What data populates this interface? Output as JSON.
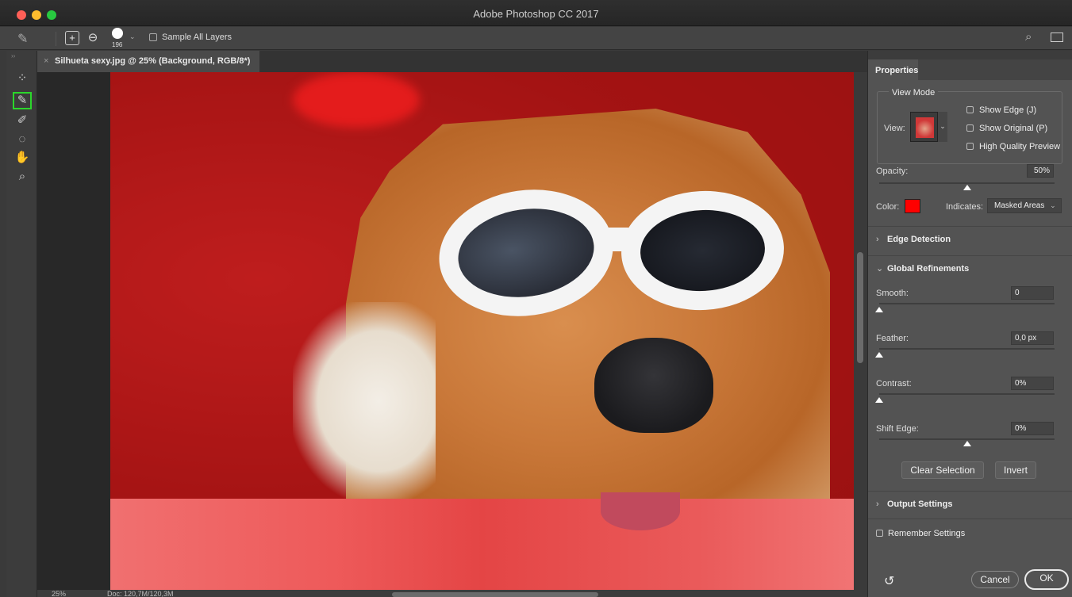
{
  "window": {
    "title": "Adobe Photoshop CC 2017"
  },
  "options_bar": {
    "brush_size": "196",
    "sample_all_layers_label": "Sample All Layers",
    "sample_all_layers_checked": false
  },
  "toolbar": {
    "tools": [
      "quick-selection-tool",
      "refine-edge-brush-tool",
      "brush-tool",
      "lasso-tool",
      "hand-tool",
      "zoom-tool"
    ],
    "active_tool": "refine-edge-brush-tool",
    "highlight_color": "#2bd62b"
  },
  "document": {
    "tab_title": "Silhueta sexy.jpg @ 25% (Background, RGB/8*)",
    "zoom": "25%",
    "doc_info": "Doc: 120,7M/120,3M",
    "overlay_color": "#ff0000"
  },
  "properties": {
    "tab_label": "Properties",
    "view_mode": {
      "title": "View Mode",
      "view_label": "View:",
      "options": [
        {
          "label": "Show Edge (J)",
          "checked": false
        },
        {
          "label": "Show Original (P)",
          "checked": false
        },
        {
          "label": "High Quality Preview",
          "checked": false
        }
      ]
    },
    "opacity": {
      "label": "Opacity:",
      "value": "50%",
      "fraction": 0.5
    },
    "color": {
      "label": "Color:",
      "swatch": "#ff0000"
    },
    "indicates": {
      "label": "Indicates:",
      "value": "Masked Areas"
    },
    "edge_detection": {
      "title": "Edge Detection",
      "expanded": false
    },
    "global_refinements": {
      "title": "Global Refinements",
      "expanded": true,
      "smooth": {
        "label": "Smooth:",
        "value": "0",
        "fraction": 0.0
      },
      "feather": {
        "label": "Feather:",
        "value": "0,0 px",
        "fraction": 0.0
      },
      "contrast": {
        "label": "Contrast:",
        "value": "0%",
        "fraction": 0.0
      },
      "shift_edge": {
        "label": "Shift Edge:",
        "value": "0%",
        "fraction": 0.5
      }
    },
    "buttons": {
      "clear_selection": "Clear Selection",
      "invert": "Invert"
    },
    "output_settings": {
      "title": "Output Settings",
      "expanded": false
    },
    "remember_settings": {
      "label": "Remember Settings",
      "checked": false
    },
    "footer": {
      "cancel": "Cancel",
      "ok": "OK"
    }
  }
}
